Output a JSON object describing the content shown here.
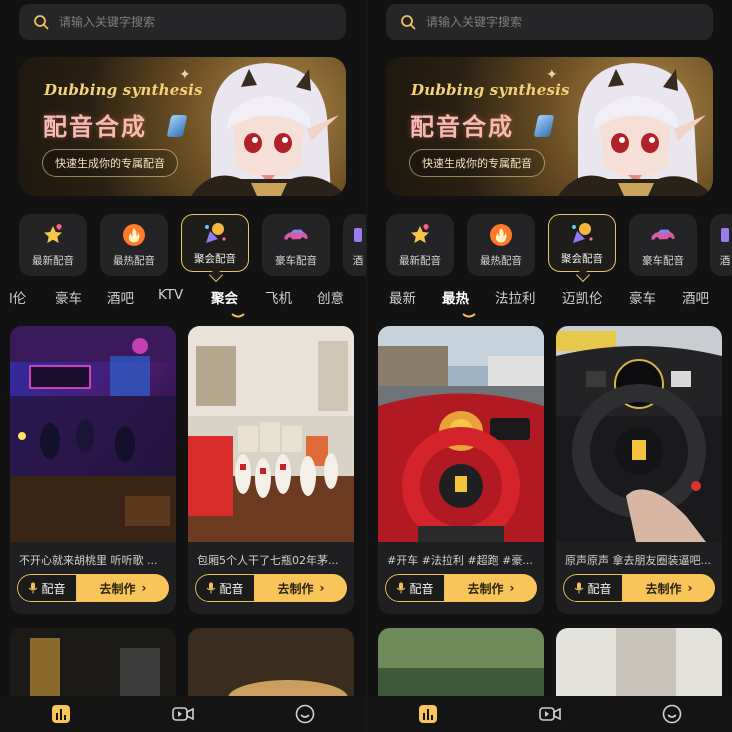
{
  "search": {
    "placeholder": "请输入关键字搜索"
  },
  "banner": {
    "title_en": "Dubbing synthesis",
    "title_cn": "配音合成",
    "subtitle": "快速生成你的专属配音"
  },
  "left": {
    "categories": [
      {
        "label": "最新配音",
        "icon": "star-heart-icon"
      },
      {
        "label": "最热配音",
        "icon": "flame-icon"
      },
      {
        "label": "聚会配音",
        "icon": "party-icon",
        "active": true
      },
      {
        "label": "豪车配音",
        "icon": "sports-car-icon"
      },
      {
        "label": "酒",
        "icon": "drink-icon"
      }
    ],
    "tabs": [
      "l伦",
      "豪车",
      "酒吧",
      "KTV",
      "聚会",
      "飞机",
      "创意"
    ],
    "active_tab": "聚会",
    "cards": [
      {
        "caption": "不开心就来胡桃里 听听歌 ...",
        "dub": "配音",
        "make": "去制作"
      },
      {
        "caption": "包厢5个人干了七瓶02年茅...",
        "dub": "配音",
        "make": "去制作"
      }
    ]
  },
  "right": {
    "categories": [
      {
        "label": "最新配音",
        "icon": "star-heart-icon"
      },
      {
        "label": "最热配音",
        "icon": "flame-icon"
      },
      {
        "label": "聚会配音",
        "icon": "party-icon",
        "active": true
      },
      {
        "label": "豪车配音",
        "icon": "sports-car-icon"
      },
      {
        "label": "酒",
        "icon": "drink-icon"
      }
    ],
    "tabs": [
      "最新",
      "最热",
      "法拉利",
      "迈凯伦",
      "豪车",
      "酒吧"
    ],
    "active_tab": "最热",
    "cards": [
      {
        "caption": "#开车 #法拉利 #超跑 #豪...",
        "dub": "配音",
        "make": "去制作"
      },
      {
        "caption": "原声原声 拿去朋友圈装逼吧...",
        "dub": "配音",
        "make": "去制作"
      }
    ]
  },
  "nav": [
    "chart-icon",
    "video-icon",
    "profile-icon"
  ],
  "colors": {
    "accent": "#f7c55a",
    "bg": "#121213",
    "card": "#1f1f21"
  }
}
